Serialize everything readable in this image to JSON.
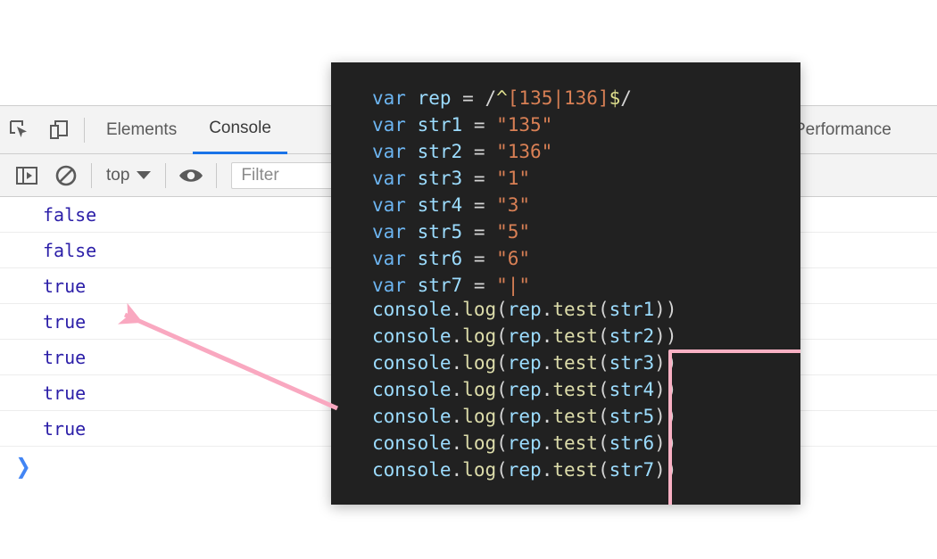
{
  "devtools": {
    "tabs": [
      {
        "label": "Elements",
        "active": false
      },
      {
        "label": "Console",
        "active": true
      },
      {
        "label": "Performance",
        "active": false
      }
    ],
    "toolbar_icons": {
      "inspect": "inspect-element-icon",
      "device": "device-toolbar-icon"
    },
    "console_toolbar": {
      "sidebar_icon": "console-sidebar-icon",
      "clear_icon": "clear-console-icon",
      "context_value": "top",
      "eye_icon": "live-expression-icon",
      "filter_placeholder": "Filter"
    },
    "console_output": [
      "false",
      "false",
      "true",
      "true",
      "true",
      "true",
      "true"
    ],
    "prompt_symbol": "❯"
  },
  "code_overlay": {
    "declarations": [
      {
        "kw": "var",
        "name": "rep",
        "eq": "=",
        "kind": "regex",
        "regex": {
          "open": "/",
          "anchor_start": "^",
          "body": "[135|136]",
          "anchor_end": "$",
          "close": "/"
        }
      },
      {
        "kw": "var",
        "name": "str1",
        "eq": "=",
        "kind": "string",
        "value": "\"135\""
      },
      {
        "kw": "var",
        "name": "str2",
        "eq": "=",
        "kind": "string",
        "value": "\"136\""
      },
      {
        "kw": "var",
        "name": "str3",
        "eq": "=",
        "kind": "string",
        "value": "\"1\""
      },
      {
        "kw": "var",
        "name": "str4",
        "eq": "=",
        "kind": "string",
        "value": "\"3\""
      },
      {
        "kw": "var",
        "name": "str5",
        "eq": "=",
        "kind": "string",
        "value": "\"5\""
      },
      {
        "kw": "var",
        "name": "str6",
        "eq": "=",
        "kind": "string",
        "value": "\"6\""
      },
      {
        "kw": "var",
        "name": "str7",
        "eq": "=",
        "kind": "string",
        "value": "\"|\""
      }
    ],
    "calls": [
      {
        "obj": "console",
        "method": "log",
        "arg_obj": "rep",
        "arg_method": "test",
        "arg": "str1"
      },
      {
        "obj": "console",
        "method": "log",
        "arg_obj": "rep",
        "arg_method": "test",
        "arg": "str2"
      },
      {
        "obj": "console",
        "method": "log",
        "arg_obj": "rep",
        "arg_method": "test",
        "arg": "str3"
      },
      {
        "obj": "console",
        "method": "log",
        "arg_obj": "rep",
        "arg_method": "test",
        "arg": "str4"
      },
      {
        "obj": "console",
        "method": "log",
        "arg_obj": "rep",
        "arg_method": "test",
        "arg": "str5"
      },
      {
        "obj": "console",
        "method": "log",
        "arg_obj": "rep",
        "arg_method": "test",
        "arg": "str6"
      },
      {
        "obj": "console",
        "method": "log",
        "arg_obj": "rep",
        "arg_method": "test",
        "arg": "str7"
      }
    ]
  },
  "annotations": {
    "highlight_color": "#f9b0c3",
    "arrow_name": "arrow-pointing-to-console-results",
    "underline_name": "regex-body-underline",
    "box_name": "console-log-calls-highlight-box"
  },
  "colors": {
    "code_background": "#212121",
    "devtools_chrome": "#f3f3f3",
    "active_tab_underline": "#1a73e8",
    "console_value_text": "#2b1ea8",
    "prompt_blue": "#4285f4",
    "annotation_pink": "#f9b0c3"
  }
}
